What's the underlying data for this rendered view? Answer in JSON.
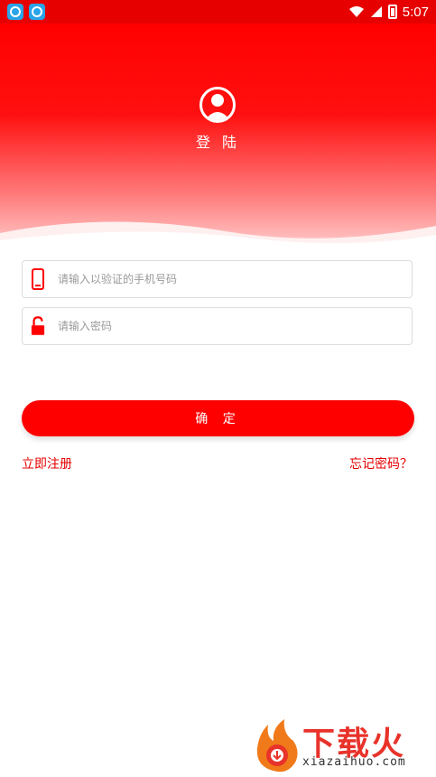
{
  "status_bar": {
    "time": "5:07"
  },
  "header": {
    "title": "登 陆"
  },
  "form": {
    "phone_placeholder": "请输入以验证的手机号码",
    "password_placeholder": "请输入密码",
    "confirm_label": "确 定"
  },
  "links": {
    "register": "立即注册",
    "forgot": "忘记密码？"
  },
  "watermark": {
    "brand": "下载火",
    "domain": "xiazaihuo.com"
  },
  "colors": {
    "accent": "#ff0000"
  }
}
